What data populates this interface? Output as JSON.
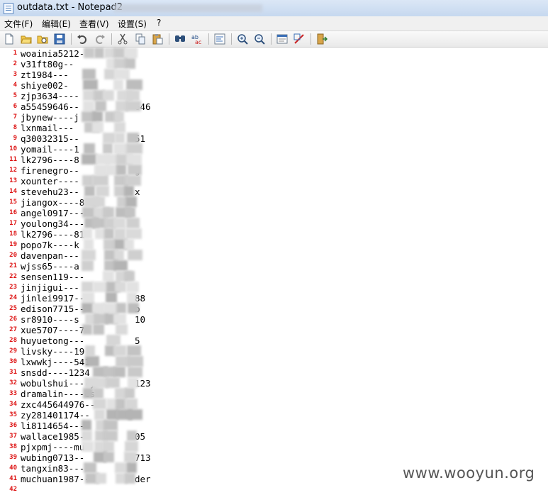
{
  "window": {
    "title": "outdata.txt - Notepad2"
  },
  "menu": {
    "file": "文件(F)",
    "edit": "编辑(E)",
    "view": "查看(V)",
    "settings": "设置(S)",
    "help": "?"
  },
  "toolbar": {
    "icons": [
      "new-file-icon",
      "open-file-icon",
      "browse-icon",
      "save-icon",
      "undo-icon",
      "redo-icon",
      "cut-icon",
      "copy-icon",
      "paste-icon",
      "find-icon",
      "replace-icon",
      "word-wrap-icon",
      "zoom-in-icon",
      "zoom-out-icon",
      "scheme-icon",
      "customize-icon",
      "exit-icon"
    ]
  },
  "editor": {
    "lines": [
      {
        "n": "1",
        "text": "woainia5212-"
      },
      {
        "n": "2",
        "text": "v31ft80g--"
      },
      {
        "n": "3",
        "text": "zt1984---"
      },
      {
        "n": "4",
        "text": "shiye002-"
      },
      {
        "n": "5",
        "text": "zjp3634----"
      },
      {
        "n": "6",
        "text": "a55459646--"
      },
      {
        "n": "7",
        "text": "jbynew----j"
      },
      {
        "n": "8",
        "text": "lxnmail---"
      },
      {
        "n": "9",
        "text": "q30032315--"
      },
      {
        "n": "10",
        "text": "yomail----1"
      },
      {
        "n": "11",
        "text": "lk2796----8"
      },
      {
        "n": "12",
        "text": "firenegro--"
      },
      {
        "n": "13",
        "text": "xounter----"
      },
      {
        "n": "14",
        "text": "stevehu23--"
      },
      {
        "n": "15",
        "text": "jiangox----8"
      },
      {
        "n": "16",
        "text": "angel0917---"
      },
      {
        "n": "17",
        "text": "youlong34---"
      },
      {
        "n": "18",
        "text": "lk2796----81"
      },
      {
        "n": "19",
        "text": "popo7k----k"
      },
      {
        "n": "20",
        "text": "davenpan---"
      },
      {
        "n": "21",
        "text": "wjss65----a"
      },
      {
        "n": "22",
        "text": "sensen119---"
      },
      {
        "n": "23",
        "text": "jinjigui---"
      },
      {
        "n": "24",
        "text": "jinlei9917--"
      },
      {
        "n": "25",
        "text": "edison7715--"
      },
      {
        "n": "26",
        "text": "sr8910----s"
      },
      {
        "n": "27",
        "text": "xue5707----7"
      },
      {
        "n": "28",
        "text": "huyuetong---"
      },
      {
        "n": "29",
        "text": "livsky----19"
      },
      {
        "n": "30",
        "text": "lxwwkj----541"
      },
      {
        "n": "31",
        "text": "snsdd----1234"
      },
      {
        "n": "32",
        "text": "wobulshui----y"
      },
      {
        "n": "33",
        "text": "dramalin----es"
      },
      {
        "n": "34",
        "text": "zxc445644976--"
      },
      {
        "n": "35",
        "text": "zy281401174--"
      },
      {
        "n": "36",
        "text": "li8114654----"
      },
      {
        "n": "37",
        "text": "wallace1985--"
      },
      {
        "n": "38",
        "text": "pjxpmj----mu"
      },
      {
        "n": "39",
        "text": "wubing0713--"
      },
      {
        "n": "40",
        "text": "tangxin83---"
      },
      {
        "n": "41",
        "text": "muchuan1987--"
      },
      {
        "n": "42",
        "text": ""
      }
    ],
    "tails": [
      {
        "row": 6,
        "text": "646"
      },
      {
        "row": 9,
        "text": "51"
      },
      {
        "row": 12,
        "text": "g"
      },
      {
        "row": 14,
        "text": "x"
      },
      {
        "row": 24,
        "text": "88"
      },
      {
        "row": 25,
        "text": "b"
      },
      {
        "row": 26,
        "text": "10"
      },
      {
        "row": 28,
        "text": "5"
      },
      {
        "row": 32,
        "text": "123"
      },
      {
        "row": 37,
        "text": "05"
      },
      {
        "row": 39,
        "text": "713"
      },
      {
        "row": 41,
        "text": "der"
      }
    ]
  },
  "watermark": "www.wooyun.org"
}
